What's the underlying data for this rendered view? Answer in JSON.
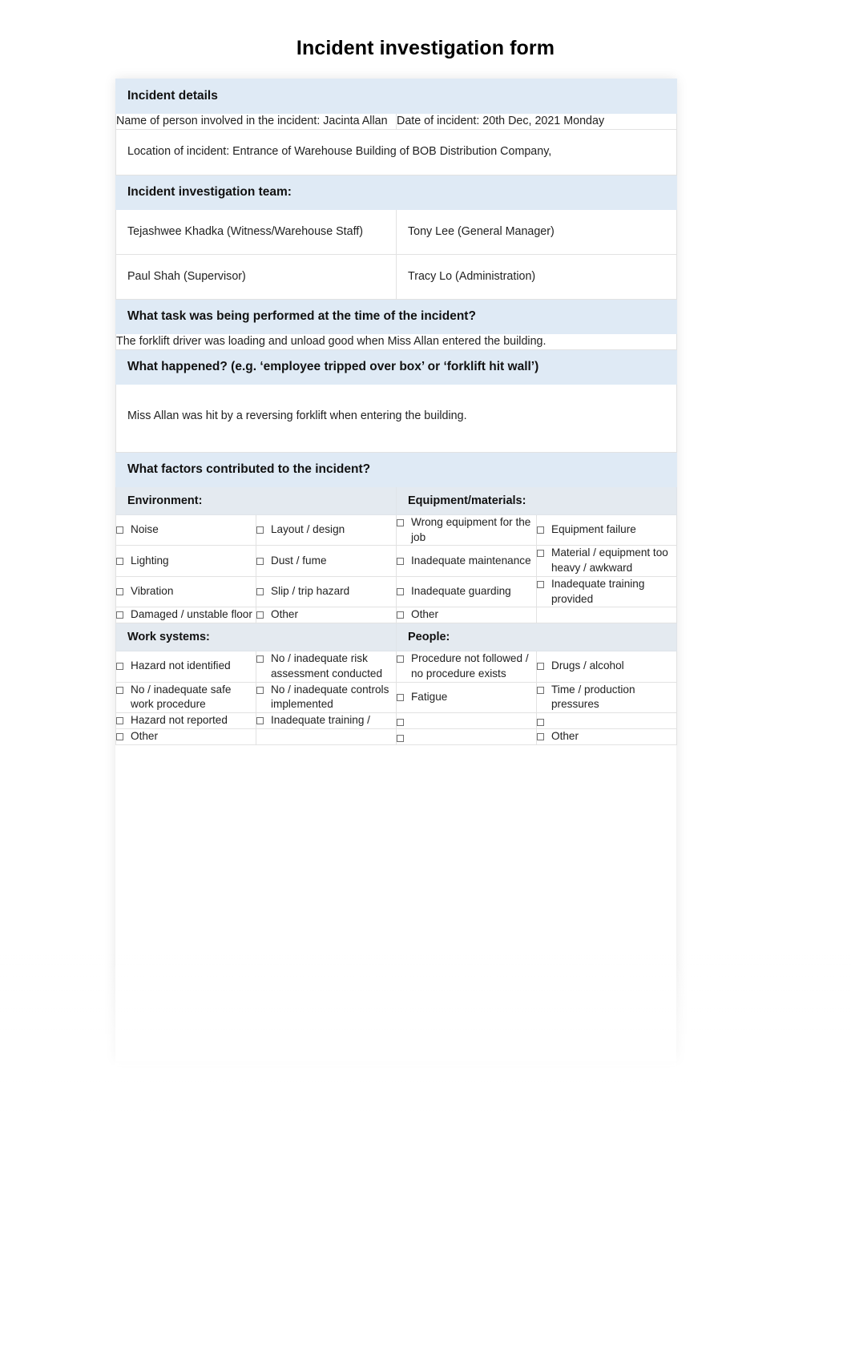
{
  "document": {
    "title": "Incident investigation form"
  },
  "sections": {
    "incident_details": {
      "heading": "Incident details",
      "name_field": "Name of person involved in the incident: Jacinta Allan",
      "date_field": "Date of incident: 20th Dec, 2021 Monday",
      "location_field": "Location of incident: Entrance of Warehouse Building of BOB Distribution Company,"
    },
    "investigation_team": {
      "heading": "Incident investigation team:",
      "members": [
        "Tejashwee Khadka (Witness/Warehouse Staff)",
        "Tony Lee (General Manager)",
        "Paul Shah (Supervisor)",
        "Tracy Lo (Administration)"
      ]
    },
    "task": {
      "heading": "What task was being performed at the time of the incident?",
      "answer": "The forklift driver was loading and unload good when Miss Allan entered the building."
    },
    "what_happened": {
      "heading": "What happened? (e.g. ‘employee tripped over box’ or ‘forklift hit wall’)",
      "answer": "Miss Allan was hit by a reversing forklift when entering the building."
    },
    "factors": {
      "heading": "What factors contributed to the incident?",
      "environment": {
        "label": "Environment:",
        "options": [
          "Noise",
          "Layout / design",
          "Lighting",
          "Dust / fume",
          "Vibration",
          "Slip / trip hazard",
          "Damaged / unstable floor",
          "Other"
        ]
      },
      "equipment": {
        "label": "Equipment/materials:",
        "options": [
          "Wrong equipment for the job",
          "Equipment failure",
          "Inadequate maintenance",
          "Material / equipment too heavy / awkward",
          "Inadequate guarding",
          "Inadequate training provided",
          "Other",
          ""
        ]
      },
      "work_systems": {
        "label": "Work systems:",
        "options": [
          "Hazard not identified",
          "No / inadequate risk assessment conducted",
          "No / inadequate safe work procedure",
          "No / inadequate controls implemented",
          "Hazard not reported",
          "Inadequate training /",
          "Other",
          ""
        ]
      },
      "people": {
        "label": "People:",
        "options": [
          "Procedure not followed / no procedure exists",
          "Drugs / alcohol",
          "Fatigue",
          "Time / production pressures",
          "",
          "",
          "",
          "Other"
        ]
      }
    }
  },
  "colors": {
    "section_header_bg": "#dfeaf5",
    "sub_header_bg": "#e4eaf0",
    "border": "#e2e2e2",
    "text": "#222222"
  },
  "icons": {
    "checkbox": "checkbox-unchecked-icon"
  }
}
